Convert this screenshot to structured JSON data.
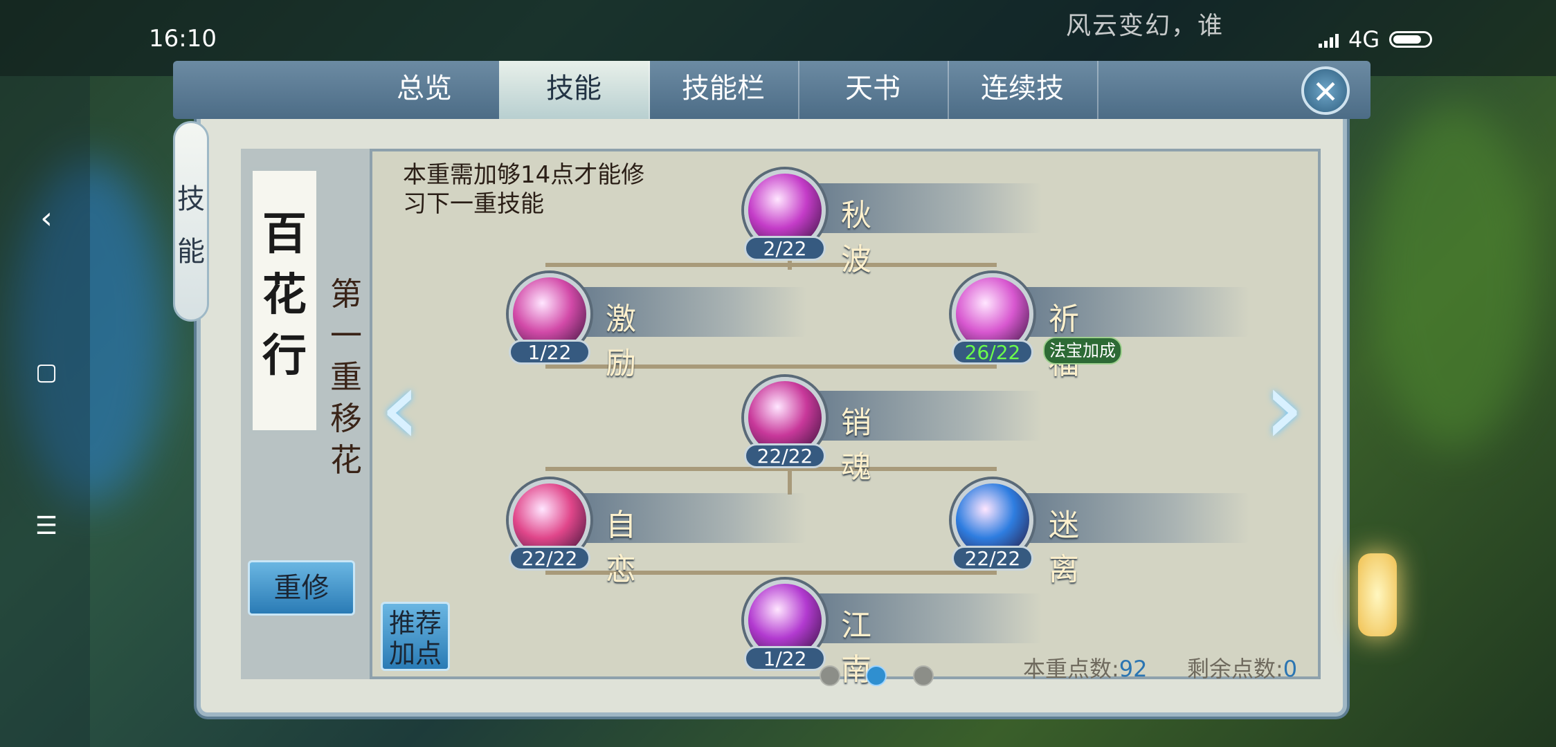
{
  "status_bar": {
    "time": "16:10",
    "marquee": "风云变幻，谁",
    "network": "4G"
  },
  "tabs": [
    {
      "label": "总览",
      "active": false
    },
    {
      "label": "技能",
      "active": true
    },
    {
      "label": "技能栏",
      "active": false
    },
    {
      "label": "天书",
      "active": false
    },
    {
      "label": "连续技",
      "active": false
    }
  ],
  "side_tag": "技能",
  "sect": {
    "scroll_title": "百花行",
    "layer_title": "第一重移花"
  },
  "hint": "本重需加够14点才能修习下一重技能",
  "skills": [
    {
      "name": "秋波",
      "level": "2/22",
      "color": "#c43cc8"
    },
    {
      "name": "激励",
      "level": "1/22",
      "color": "#d24aa8"
    },
    {
      "name": "祈福",
      "level": "26/22",
      "level_color": "green",
      "badge": "法宝加成",
      "color": "#d858d0"
    },
    {
      "name": "销魂",
      "level": "22/22",
      "color": "#c8389a"
    },
    {
      "name": "自恋",
      "level": "22/22",
      "color": "#e0468a"
    },
    {
      "name": "迷离",
      "level": "22/22",
      "color": "#2e7de0"
    },
    {
      "name": "江南",
      "level": "1/22",
      "color": "#b23ad0"
    }
  ],
  "buttons": {
    "rebuild": "重修",
    "recommend": "推荐加点",
    "close": "✕"
  },
  "pagination": {
    "pages": 3,
    "current": 2
  },
  "points": {
    "layer_label": "本重点数:",
    "layer_value": "92",
    "remain_label": "剩余点数:",
    "remain_value": "0"
  }
}
